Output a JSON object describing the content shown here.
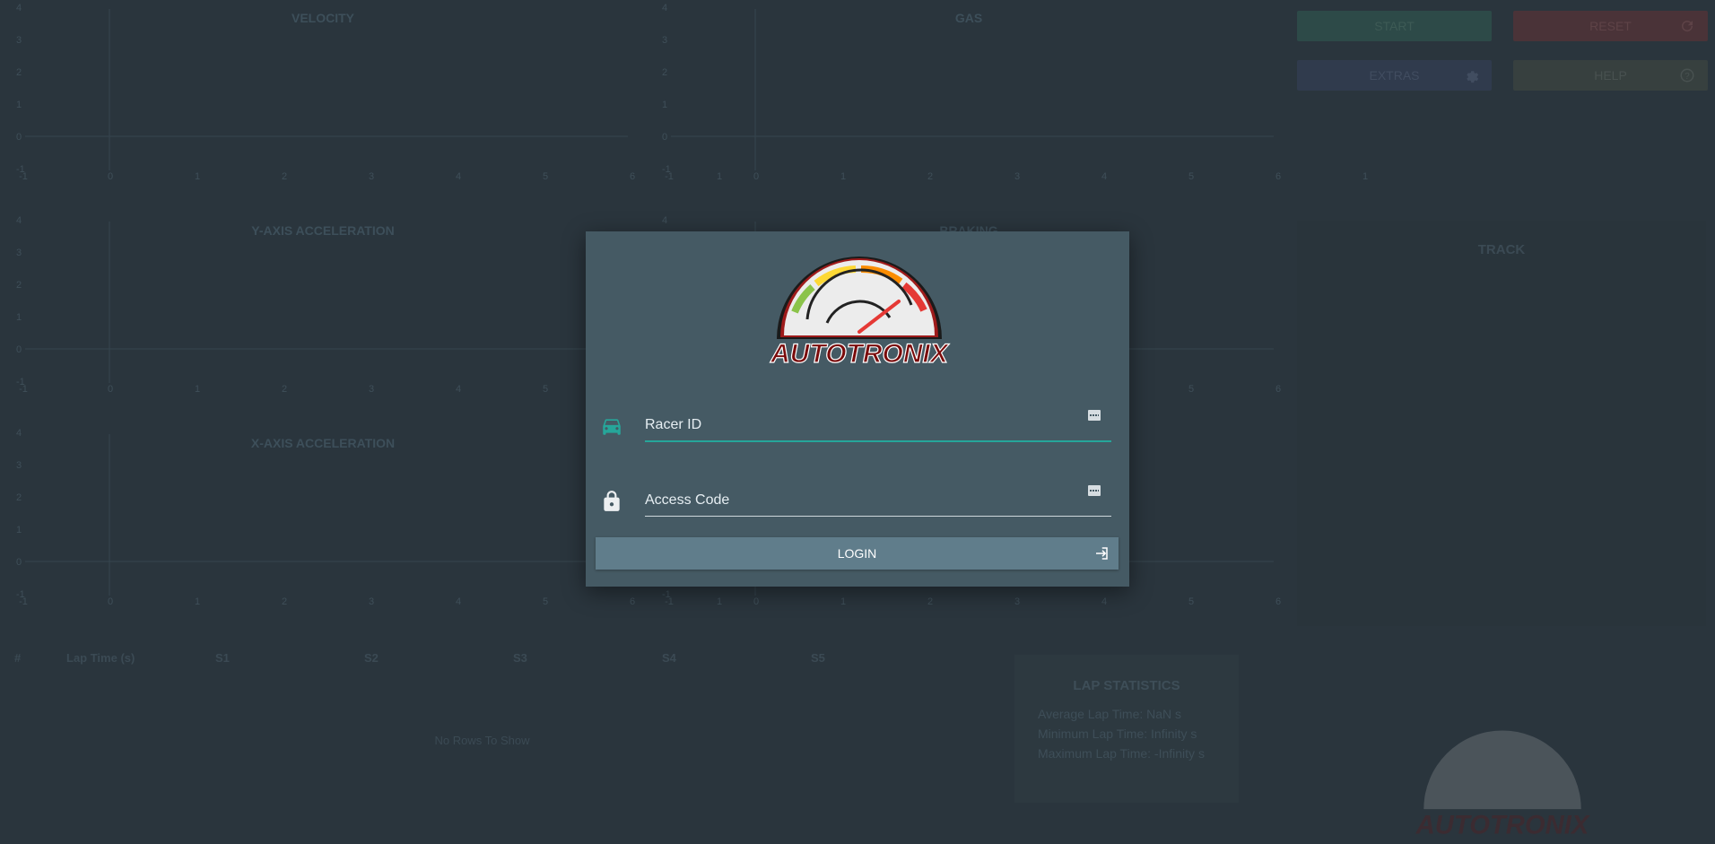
{
  "app": {
    "brand": "AUTOTRONIX"
  },
  "charts": [
    {
      "id": "velocity",
      "title": "VELOCITY"
    },
    {
      "id": "gas",
      "title": "GAS"
    },
    {
      "id": "y_accel",
      "title": "Y-AXIS ACCELERATION"
    },
    {
      "id": "braking",
      "title": "BRAKING"
    },
    {
      "id": "x_accel",
      "title": "X-AXIS ACCELERATION"
    },
    {
      "id": "steering",
      "title": ""
    }
  ],
  "chart_axes": {
    "x_ticks": [
      "-1",
      "0",
      "1",
      "2",
      "3",
      "4",
      "5",
      "6",
      "1"
    ],
    "y_ticks": [
      "-1",
      "0",
      "1",
      "2",
      "3",
      "4"
    ]
  },
  "controls": {
    "start_label": "START",
    "reset_label": "RESET",
    "extras_label": "EXTRAS",
    "help_label": "HELP"
  },
  "track": {
    "title": "TRACK"
  },
  "laps": {
    "columns": [
      "#",
      "Lap Time (s)",
      "S1",
      "S2",
      "S3",
      "S4",
      "S5"
    ],
    "empty_text": "No Rows To Show"
  },
  "stats": {
    "title": "LAP STATISTICS",
    "lines": [
      "Average Lap Time: NaN s",
      "Minimum Lap Time: Infinity s",
      "Maximum Lap Time: -Infinity s"
    ]
  },
  "login": {
    "racer_id_placeholder": "Racer ID",
    "access_code_placeholder": "Access Code",
    "login_label": "LOGIN"
  },
  "colors": {
    "teal_accent": "#26a69a",
    "modal_bg": "#455a64",
    "button_bg": "#607d8b",
    "brand_red": "#8b0000"
  }
}
